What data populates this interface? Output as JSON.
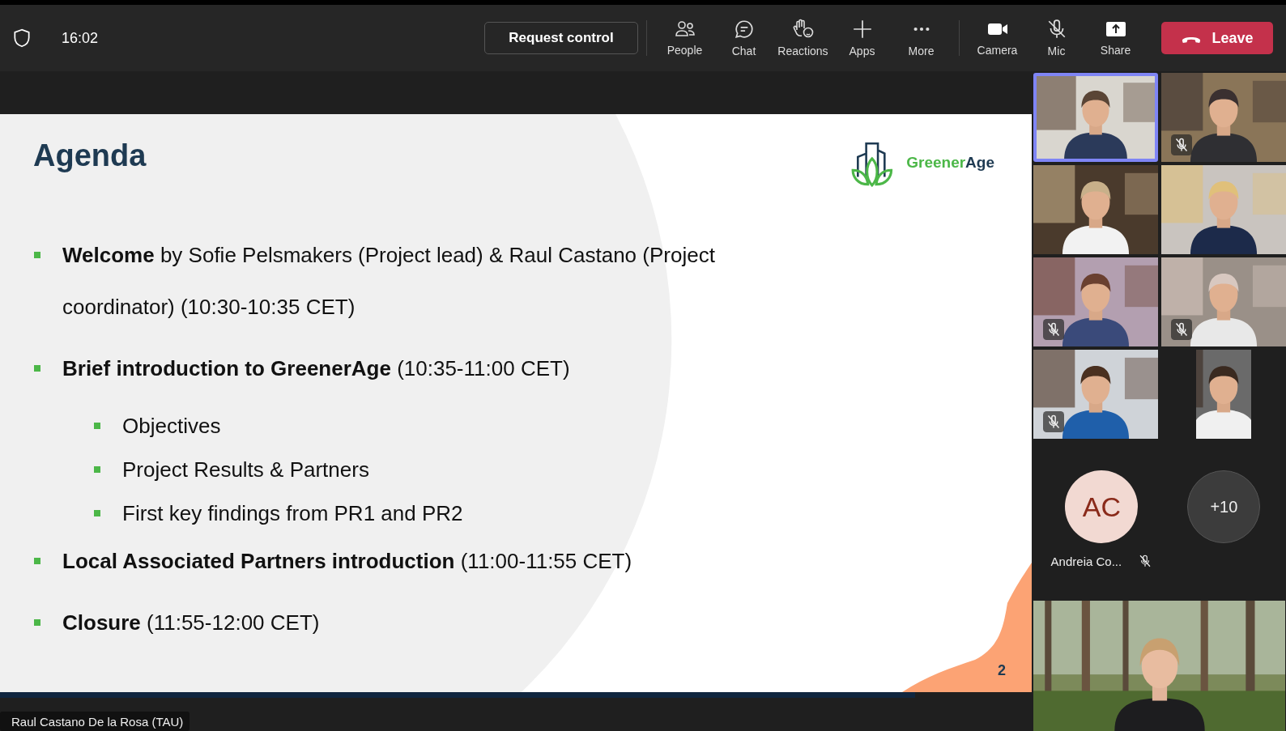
{
  "top_bar": {
    "time": "16:02",
    "request_control": "Request control",
    "buttons": [
      {
        "kind": "people",
        "label": "People"
      },
      {
        "kind": "chat",
        "label": "Chat"
      },
      {
        "kind": "reactions",
        "label": "Reactions"
      },
      {
        "kind": "apps",
        "label": "Apps"
      },
      {
        "kind": "more",
        "label": "More"
      },
      {
        "kind": "camera",
        "label": "Camera"
      },
      {
        "kind": "mic-off",
        "label": "Mic"
      },
      {
        "kind": "share",
        "label": "Share"
      }
    ],
    "leave": "Leave"
  },
  "slide": {
    "title": "Agenda",
    "logo": {
      "green": "Greener",
      "dark": "Age"
    },
    "page": "2",
    "items": [
      {
        "text": "**Welcome** by Sofie Pelsmakers (Project lead) & Raul Castano (Project coordinator) (10:30-10:35 CET)"
      },
      {
        "text": "**Brief introduction to GreenerAge** (10:35-11:00 CET)",
        "children": [
          {
            "text": "Objectives"
          },
          {
            "text": "Project Results & Partners"
          },
          {
            "text": "First key findings from PR1 and PR2"
          }
        ]
      },
      {
        "text": "**Local Associated Partners introduction** (11:00-11:55 CET)"
      },
      {
        "text": "**Closure** (11:55-12:00 CET)"
      }
    ]
  },
  "presenter": "Raul Castano De la Rosa (TAU)",
  "video_tiles": [
    {
      "speaking": true,
      "muted": false
    },
    {
      "speaking": false,
      "muted": true
    },
    {
      "speaking": false,
      "muted": false
    },
    {
      "speaking": false,
      "muted": false
    },
    {
      "speaking": false,
      "muted": true
    },
    {
      "speaking": false,
      "muted": true
    },
    {
      "speaking": false,
      "muted": true
    },
    {
      "speaking": false,
      "muted": false
    }
  ],
  "avatars": [
    {
      "kind": "initials",
      "initials": "AC",
      "name": "Andreia Co...",
      "muted": true
    },
    {
      "kind": "overflow",
      "count": "+10"
    }
  ]
}
